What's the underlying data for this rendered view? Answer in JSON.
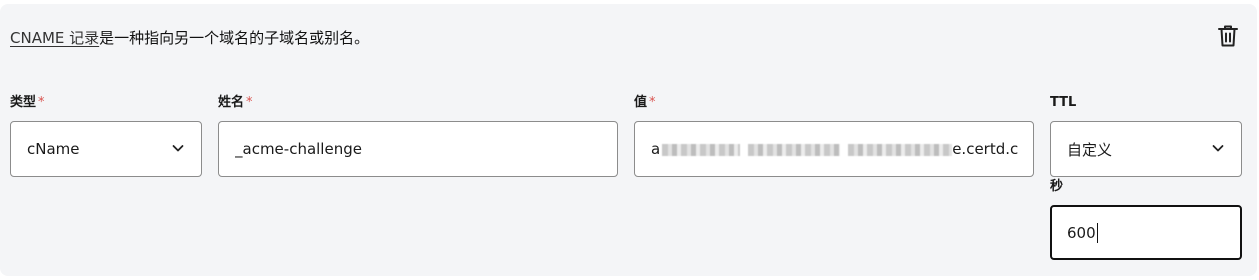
{
  "description": {
    "link_text": "CNAME 记录",
    "text": "是一种指向另一个域名的子域名或别名。"
  },
  "fields": {
    "type": {
      "label": "类型",
      "required_mark": "*",
      "value": "cName"
    },
    "name": {
      "label": "姓名",
      "required_mark": "*",
      "value": "_acme-challenge"
    },
    "value": {
      "label": "值",
      "required_mark": "*",
      "value_prefix": "a",
      "value_suffix": "e.certd.c"
    },
    "ttl": {
      "label": "TTL",
      "value": "自定义"
    },
    "seconds": {
      "label": "秒",
      "value": "600"
    }
  },
  "icons": {
    "delete": "trash-icon",
    "dropdown": "chevron-down-icon"
  },
  "colors": {
    "card_background": "#f4f5f7",
    "required": "#d9534f",
    "border": "#8c8c8c",
    "focus_border": "#111111"
  }
}
